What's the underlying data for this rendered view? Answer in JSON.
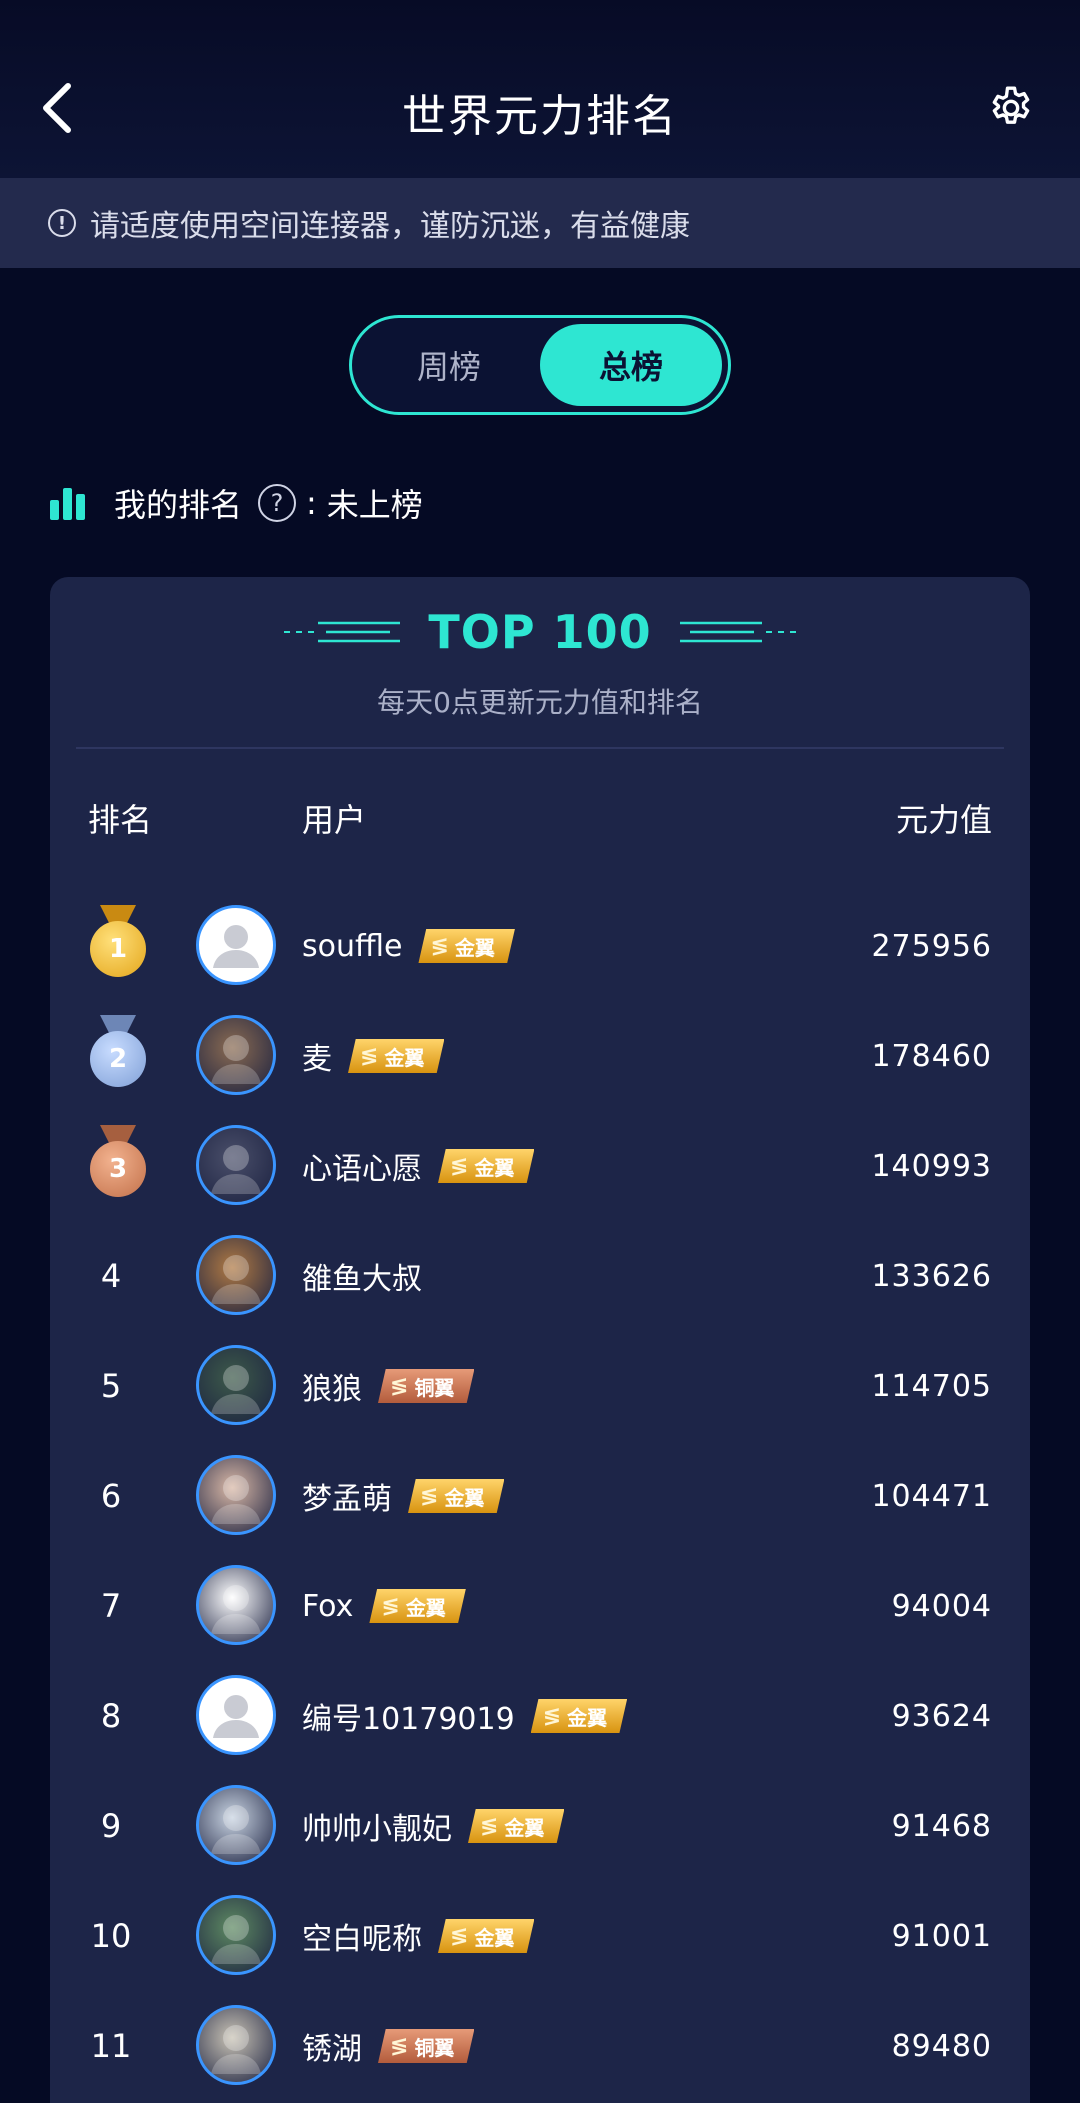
{
  "header": {
    "title": "世界元力排名",
    "back_icon": "chevron-left-icon",
    "settings_icon": "gear-icon"
  },
  "notice": {
    "icon": "info-icon",
    "text": "请适度使用空间连接器，谨防沉迷，有益健康"
  },
  "tabs": [
    {
      "label": "周榜",
      "active": false
    },
    {
      "label": "总榜",
      "active": true
    }
  ],
  "my_rank": {
    "label": "我的排名",
    "status": "未上榜",
    "help_glyph": "?",
    "separator": ":"
  },
  "leaderboard": {
    "title": "TOP 100",
    "subtitle": "每天0点更新元力值和排名",
    "columns": {
      "rank": "排名",
      "user": "用户",
      "score": "元力值"
    },
    "rows": [
      {
        "rank": "1",
        "medal": "gold",
        "name": "souffle",
        "badge": "金翼",
        "badge_type": "gold",
        "score": "275956",
        "avatar": "default-avatar"
      },
      {
        "rank": "2",
        "medal": "silver",
        "name": "麦",
        "badge": "金翼",
        "badge_type": "gold",
        "score": "178460",
        "avatar": "photo-avatar"
      },
      {
        "rank": "3",
        "medal": "bronze",
        "name": "心语心愿",
        "badge": "金翼",
        "badge_type": "gold",
        "score": "140993",
        "avatar": "photo-avatar"
      },
      {
        "rank": "4",
        "medal": null,
        "name": "雒鱼大叔",
        "badge": "",
        "badge_type": "",
        "score": "133626",
        "avatar": "photo-avatar"
      },
      {
        "rank": "5",
        "medal": null,
        "name": "狼狼",
        "badge": "铜翼",
        "badge_type": "bronze",
        "score": "114705",
        "avatar": "photo-avatar"
      },
      {
        "rank": "6",
        "medal": null,
        "name": "梦孟萌",
        "badge": "金翼",
        "badge_type": "gold",
        "score": "104471",
        "avatar": "photo-avatar"
      },
      {
        "rank": "7",
        "medal": null,
        "name": "Fox",
        "badge": "金翼",
        "badge_type": "gold",
        "score": "94004",
        "avatar": "photo-avatar"
      },
      {
        "rank": "8",
        "medal": null,
        "name": "编号10179019",
        "badge": "金翼",
        "badge_type": "gold",
        "score": "93624",
        "avatar": "default-avatar"
      },
      {
        "rank": "9",
        "medal": null,
        "name": "帅帅小靓妃",
        "badge": "金翼",
        "badge_type": "gold",
        "score": "91468",
        "avatar": "photo-avatar"
      },
      {
        "rank": "10",
        "medal": null,
        "name": "空白呢称",
        "badge": "金翼",
        "badge_type": "gold",
        "score": "91001",
        "avatar": "photo-avatar"
      },
      {
        "rank": "11",
        "medal": null,
        "name": "锈湖",
        "badge": "铜翼",
        "badge_type": "bronze",
        "score": "89480",
        "avatar": "photo-avatar"
      }
    ]
  },
  "colors": {
    "accent": "#2ee6d2",
    "background": "#050a24",
    "card": "#1d2548",
    "notice_bg": "#232a4d",
    "avatar_ring": "#3a95ff"
  }
}
